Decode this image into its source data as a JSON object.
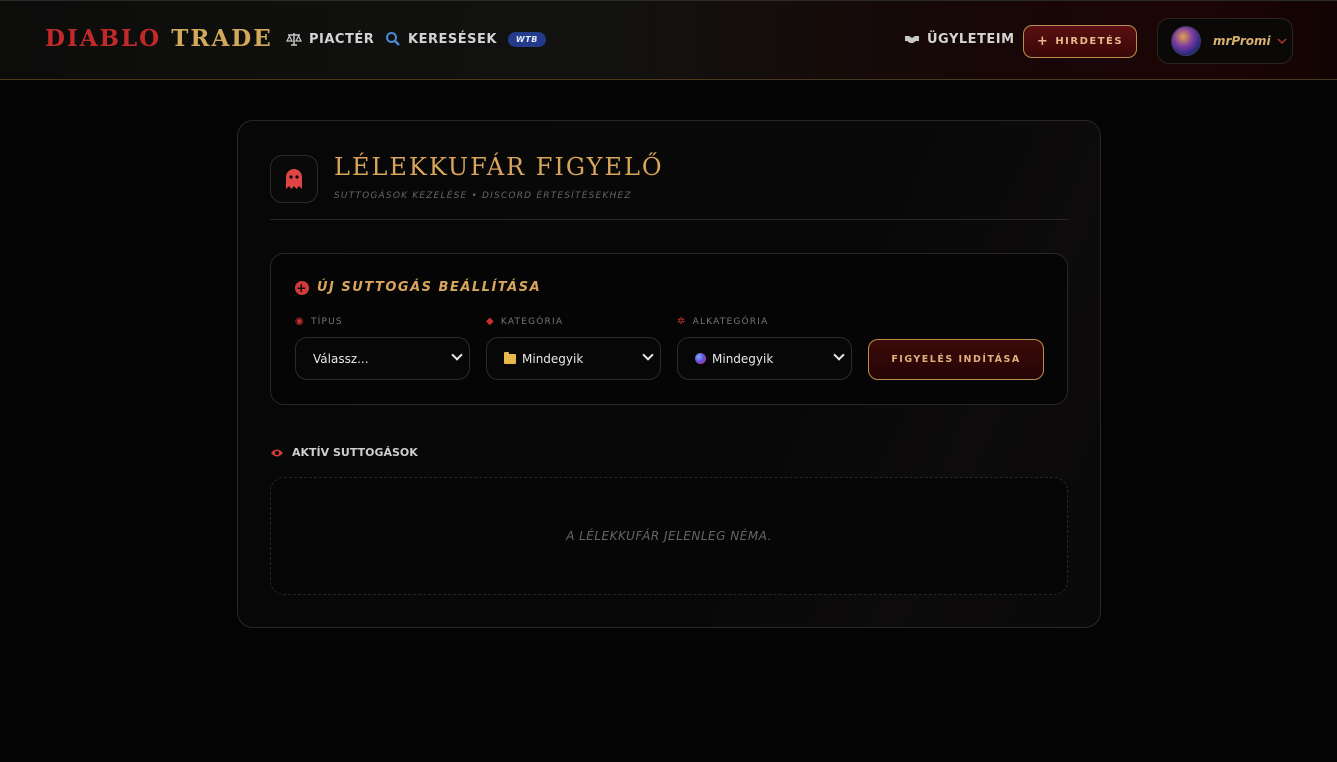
{
  "nav": {
    "brand_part1": "DIABLO",
    "brand_part2": "TRADE",
    "market_label": "PIACTÉR",
    "searches_label": "KERESÉSEK",
    "searches_badge": "WTB",
    "deals_label": "ÜGYLETEIM",
    "advert_label": "HIRDETÉS",
    "advert_icon": "+",
    "username": "mrPromi",
    "icons": [
      "scale-icon",
      "search-icon",
      "handshake-icon",
      "chevron-down-icon"
    ]
  },
  "card": {
    "title": "LÉLEKKUFÁR FIGYELŐ",
    "subtitle": "SUTTOGÁSOK KEZELÉSE • DISCORD ÉRTESÍTÉSEKHEZ",
    "icon": "ghost-icon"
  },
  "setup": {
    "title": "ÚJ SUTTOGÁS BEÁLLÍTÁSA",
    "type_label": "TÍPUS",
    "type_value": "Válassz...",
    "category_label": "KATEGÓRIA",
    "category_value": "Mindegyik",
    "subcategory_label": "ALKATEGÓRIA",
    "subcategory_value": "Mindegyik",
    "start_button": "FIGYELÉS INDÍTÁSA"
  },
  "active": {
    "label": "AKTÍV SUTTOGÁSOK",
    "empty_text": "A LÉLEKKUFÁR JELENLEG NÉMA."
  },
  "colors": {
    "accent_gold": "#d9a55c",
    "accent_red": "#c22a2a",
    "badge_blue": "#243a8a",
    "background": "#040404"
  }
}
